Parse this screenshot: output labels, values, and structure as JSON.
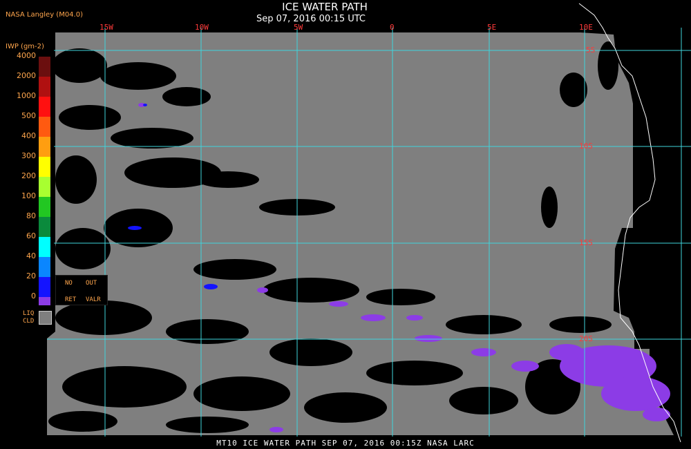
{
  "header": {
    "title": "ICE WATER PATH",
    "subtitle": "Sep 07, 2016 00:15 UTC",
    "source": "NASA Langley (M04.0)"
  },
  "map": {
    "longitude_labels": [
      "15W",
      "10W",
      "5W",
      "0",
      "5E",
      "10E"
    ],
    "latitude_labels": [
      "5S",
      "10S",
      "15S",
      "20S"
    ],
    "colors": {
      "background": "#000000",
      "cloud_liquid": "#7f7f7f",
      "grid": "#3fd6dc",
      "grid_label": "#ff3a3a",
      "ice": "#8c3ce6",
      "coastline": "#ffffff"
    }
  },
  "legend": {
    "unit": "IWP (gm-2)",
    "ticks": [
      "4000",
      "2000",
      "1000",
      "500",
      "400",
      "300",
      "200",
      "100",
      "80",
      "60",
      "40",
      "20",
      "0"
    ],
    "colors": [
      "#6b0f0f",
      "#b01010",
      "#ff1010",
      "#ff5a10",
      "#ff9e10",
      "#ffff00",
      "#a8ff30",
      "#22c722",
      "#0a8a3c",
      "#00ffff",
      "#0a86ff",
      "#1414ff",
      "#8c3ce6"
    ],
    "no_ret": {
      "line1": "NO",
      "line2": "RET"
    },
    "out_valr": {
      "line1": "OUT",
      "line2": "VALR"
    },
    "liq_cld": {
      "line1": "LIQ",
      "line2": "CLD"
    }
  },
  "footer": {
    "caption": "MT10  ICE WATER PATH  SEP 07, 2016 00:15Z  NASA LARC"
  }
}
